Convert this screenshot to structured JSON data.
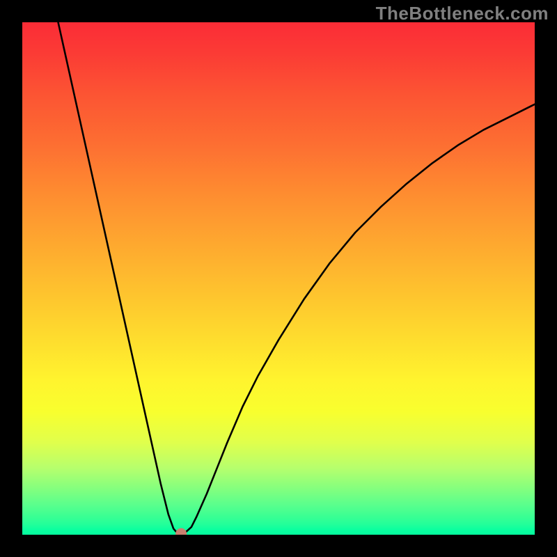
{
  "watermark": "TheBottleneck.com",
  "chart_data": {
    "type": "line",
    "title": "",
    "xlabel": "",
    "ylabel": "",
    "xlim": [
      0,
      100
    ],
    "ylim": [
      0,
      100
    ],
    "grid": false,
    "series": [
      {
        "name": "bottleneck-curve",
        "x": [
          7,
          9,
          11,
          13,
          15,
          17,
          19,
          21,
          23,
          25,
          27,
          28.5,
          29.5,
          30,
          30.5,
          31,
          31.5,
          32,
          33,
          34,
          36,
          38,
          40,
          43,
          46,
          50,
          55,
          60,
          65,
          70,
          75,
          80,
          85,
          90,
          95,
          100
        ],
        "y": [
          100,
          91,
          82,
          73,
          64,
          55,
          46,
          37,
          28,
          19,
          10,
          4,
          1.2,
          0.6,
          0.3,
          0.2,
          0.3,
          0.6,
          1.5,
          3.5,
          8,
          13,
          18,
          25,
          31,
          38,
          46,
          53,
          59,
          64,
          68.5,
          72.5,
          76,
          79,
          81.5,
          84
        ]
      }
    ],
    "marker": {
      "x": 31,
      "y": 0.2,
      "color": "#c98070",
      "radius_px": 8
    },
    "gradient_stops": [
      {
        "pos": 0.0,
        "color": "#fb2c36"
      },
      {
        "pos": 0.5,
        "color": "#fec02f"
      },
      {
        "pos": 0.75,
        "color": "#fcff2e"
      },
      {
        "pos": 1.0,
        "color": "#05fb9e"
      }
    ]
  }
}
